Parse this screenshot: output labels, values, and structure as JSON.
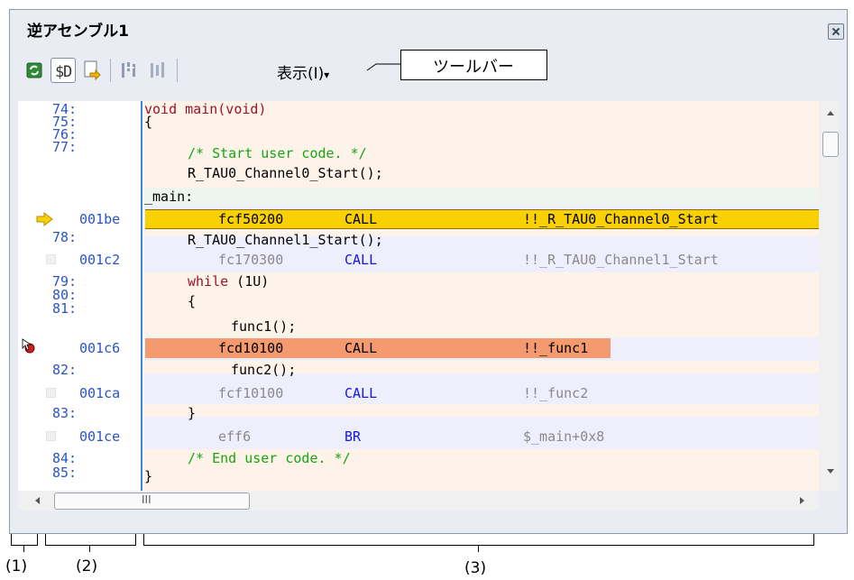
{
  "window": {
    "title": "逆アセンブル1"
  },
  "toolbar": {
    "view_menu_label": "表示(I)",
    "view_menu_arrow": "▾",
    "buttons": [
      "refresh-icon",
      "mix-display-icon",
      "go-to-symbol-icon",
      "step-in-icon",
      "step-out-icon"
    ]
  },
  "callout": {
    "label": "ツールバー"
  },
  "code": {
    "lines": [
      {
        "num": "74:",
        "source": "void main(void)"
      },
      {
        "num": "75:",
        "source": "{"
      },
      {
        "num": "76:",
        "source": "/* Start user code. */"
      },
      {
        "num": "77:",
        "source": "R_TAU0_Channel0_Start();"
      },
      {
        "label": "_main:"
      },
      {
        "addr": "001be",
        "code": "fcf50200",
        "mnemonic": "CALL",
        "operand": "!!_R_TAU0_Channel0_Start"
      },
      {
        "num": "78:",
        "source": "R_TAU0_Channel1_Start();"
      },
      {
        "addr": "001c2",
        "code": "fc170300",
        "mnemonic": "CALL",
        "operand": "!!_R_TAU0_Channel1_Start"
      },
      {
        "num": "79:",
        "keyword": "while",
        "source": " (1U)"
      },
      {
        "num": "80:",
        "source": "{"
      },
      {
        "num": "81:",
        "source": "func1();"
      },
      {
        "addr": "001c6",
        "code": "fcd10100",
        "mnemonic": "CALL",
        "operand": "!!_func1"
      },
      {
        "num": "82:",
        "source": "func2();"
      },
      {
        "addr": "001ca",
        "code": "fcf10100",
        "mnemonic": "CALL",
        "operand": "!!_func2"
      },
      {
        "num": "83:",
        "source": "}"
      },
      {
        "addr": "001ce",
        "code": "eff6",
        "mnemonic": "BR",
        "operand": "$_main+0x8"
      },
      {
        "num": "84:",
        "source": "/* End user code. */"
      },
      {
        "num": "85:",
        "source": "}"
      }
    ]
  },
  "scrollbar": {
    "h_grip": "III"
  },
  "annotations": {
    "label1": "(1)",
    "label2": "(2)",
    "label3": "(3)"
  },
  "colors": {
    "current_pc_highlight": "#f9d000",
    "breakpoint_highlight": "#f49a6e",
    "source_band": "#fdf3e8",
    "asm_band": "#eeeefd",
    "label_band": "#eef4ee"
  }
}
